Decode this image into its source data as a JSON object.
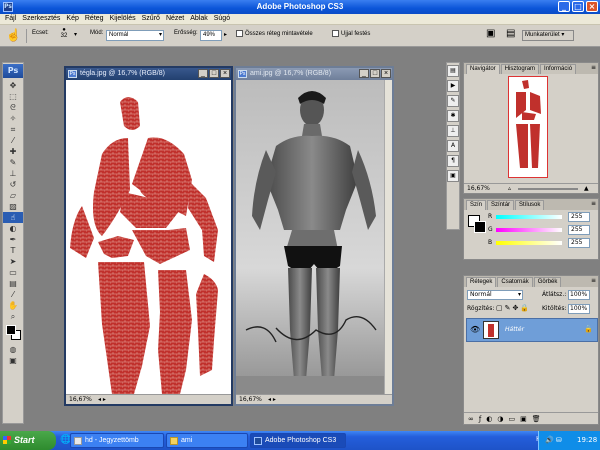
{
  "app": {
    "title": "Adobe Photoshop CS3",
    "logo_text": "Ps"
  },
  "menu": [
    "Fájl",
    "Szerkesztés",
    "Kép",
    "Réteg",
    "Kijelölés",
    "Szűrő",
    "Nézet",
    "Ablak",
    "Súgó"
  ],
  "options": {
    "brush_label": "Ecset:",
    "brush_size": "32",
    "mode_label": "Mód:",
    "mode_value": "Normál",
    "strength_label": "Erősség:",
    "strength_value": "49%",
    "all_layers_label": "Összes réteg mintavétele",
    "finger_paint_label": "Ujjal festés",
    "workspace_label": "Munkaterület"
  },
  "documents": [
    {
      "title": "tégla.jpg @ 16,7% (RGB/8)",
      "zoom": "16,67%"
    },
    {
      "title": "ami.jpg @ 16,7% (RGB/8)",
      "zoom": "16,67%"
    }
  ],
  "navigator": {
    "tabs": [
      "Navigátor",
      "Hisztogram",
      "Információ"
    ],
    "zoom": "16,67%"
  },
  "color_panel": {
    "tabs": [
      "Szín",
      "Színtár",
      "Stílusok"
    ],
    "channels": [
      {
        "label": "R",
        "value": "255"
      },
      {
        "label": "G",
        "value": "255"
      },
      {
        "label": "B",
        "value": "255"
      }
    ]
  },
  "layers_panel": {
    "tabs": [
      "Rétegek",
      "Csatornák",
      "Görbék"
    ],
    "blend_mode": "Normál",
    "opacity_label": "Átlátsz.:",
    "opacity_value": "100%",
    "lock_label": "Rögzítés:",
    "fill_label": "Kitöltés:",
    "fill_value": "100%",
    "layer_name": "Háttér"
  },
  "taskbar": {
    "start_label": "Start",
    "buttons": [
      "hd - Jegyzettömb",
      "ami",
      "Adobe Photoshop CS3"
    ],
    "lang": "HU",
    "time": "19:28"
  },
  "colors": {
    "brick_red": "#c0302c",
    "ps_blue": "#22406f",
    "xp_blue": "#245edb"
  }
}
